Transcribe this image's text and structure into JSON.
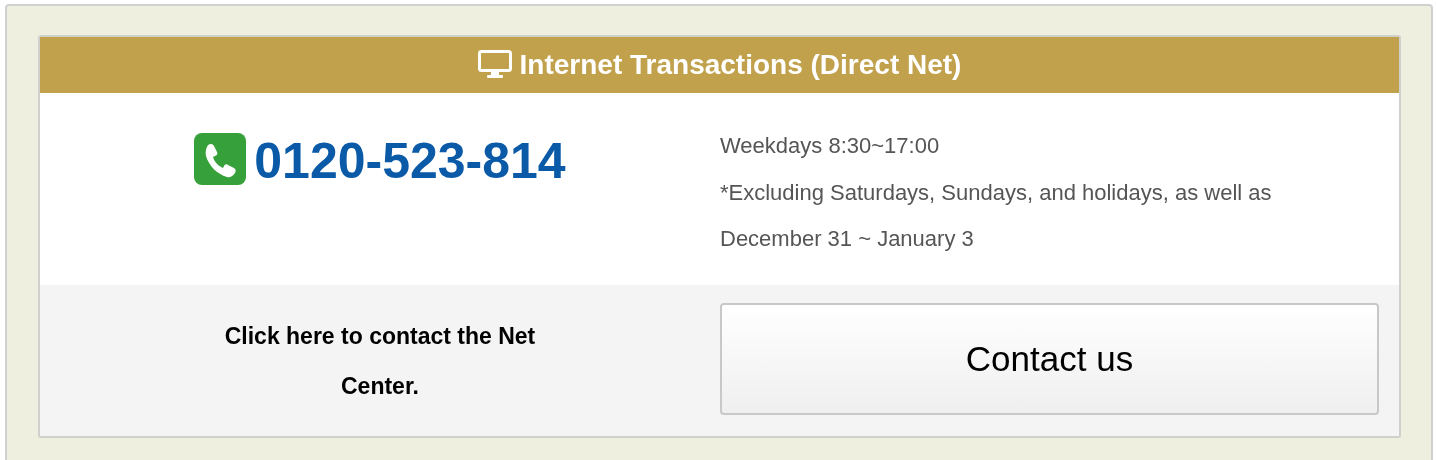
{
  "header": {
    "title": "Internet Transactions (Direct Net)"
  },
  "phone": {
    "number": "0120-523-814"
  },
  "hours": {
    "lines": [
      "Weekdays 8:30~17:00",
      "*Excluding Saturdays, Sundays, and holidays, as well as December 31 ~ January 3"
    ]
  },
  "contact": {
    "prompt": "Click here to contact the Net Center.",
    "button": "Contact us"
  }
}
